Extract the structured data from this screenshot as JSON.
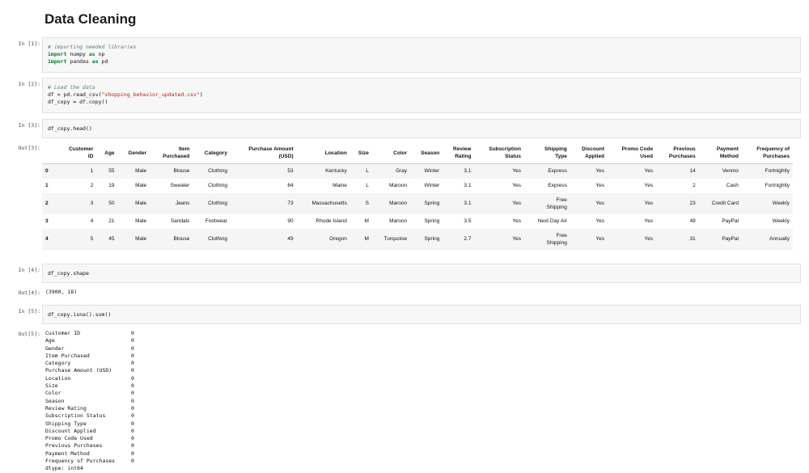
{
  "title": "Data Cleaning",
  "cells": [
    {
      "in": "In [1]:",
      "lines": [
        {
          "comment": "# importing needed libraries"
        },
        {
          "kw1": "import",
          "rest1": " numpy ",
          "kw2": "as",
          "rest2": " np"
        },
        {
          "kw1": "import",
          "rest1": " pandas ",
          "kw2": "as",
          "rest2": " pd"
        }
      ]
    },
    {
      "in": "In [2]:",
      "comment": "# Load the data",
      "line2_a": "df = pd.read_csv(",
      "line2_str": "\"shopping_behavior_updated.csv\"",
      "line2_b": ")",
      "line3": "df_copy = df.copy()"
    },
    {
      "in": "In [3]:",
      "code": "df_copy.head()",
      "out": "Out[3]:"
    },
    {
      "in": "In [4]:",
      "code": "df_copy.shape",
      "out": "Out[4]:",
      "result": "(3900, 18)"
    },
    {
      "in": "In [5]:",
      "code": "df_copy.isna().sum()",
      "out": "Out[5]:"
    }
  ],
  "table": {
    "columns": [
      [
        "Customer",
        "ID"
      ],
      [
        "Age",
        ""
      ],
      [
        "Gender",
        ""
      ],
      [
        "Item",
        "Purchased"
      ],
      [
        "Category",
        ""
      ],
      [
        "Purchase Amount",
        "(USD)"
      ],
      [
        "Location",
        ""
      ],
      [
        "Size",
        ""
      ],
      [
        "Color",
        ""
      ],
      [
        "Season",
        ""
      ],
      [
        "Review",
        "Rating"
      ],
      [
        "Subscription",
        "Status"
      ],
      [
        "Shipping",
        "Type"
      ],
      [
        "Discount",
        "Applied"
      ],
      [
        "Promo Code",
        "Used"
      ],
      [
        "Previous",
        "Purchases"
      ],
      [
        "Payment",
        "Method"
      ],
      [
        "Frequency of",
        "Purchases"
      ]
    ],
    "rows": [
      {
        "idx": "0",
        "cells": [
          "1",
          "55",
          "Male",
          "Blouse",
          "Clothing",
          "53",
          "Kentucky",
          "L",
          "Gray",
          "Winter",
          "3.1",
          "Yes",
          [
            "Express",
            ""
          ],
          "Yes",
          "Yes",
          "14",
          "Venmo",
          "Fortnightly"
        ]
      },
      {
        "idx": "1",
        "cells": [
          "2",
          "19",
          "Male",
          "Sweater",
          "Clothing",
          "64",
          "Maine",
          "L",
          "Maroon",
          "Winter",
          "3.1",
          "Yes",
          [
            "Express",
            ""
          ],
          "Yes",
          "Yes",
          "2",
          "Cash",
          "Fortnightly"
        ]
      },
      {
        "idx": "2",
        "cells": [
          "3",
          "50",
          "Male",
          "Jeans",
          "Clothing",
          "73",
          "Massachusetts",
          "S",
          "Maroon",
          "Spring",
          "3.1",
          "Yes",
          [
            "Free",
            "Shipping"
          ],
          "Yes",
          "Yes",
          "23",
          "Credit Card",
          "Weekly"
        ]
      },
      {
        "idx": "3",
        "cells": [
          "4",
          "21",
          "Male",
          "Sandals",
          "Footwear",
          "90",
          "Rhode Island",
          "M",
          "Maroon",
          "Spring",
          "3.5",
          "Yes",
          [
            "Next Day Air",
            ""
          ],
          "Yes",
          "Yes",
          "49",
          "PayPal",
          "Weekly"
        ]
      },
      {
        "idx": "4",
        "cells": [
          "5",
          "45",
          "Male",
          "Blouse",
          "Clothing",
          "49",
          "Oregon",
          "M",
          "Turquoise",
          "Spring",
          "2.7",
          "Yes",
          [
            "Free",
            "Shipping"
          ],
          "Yes",
          "Yes",
          "31",
          "PayPal",
          "Annually"
        ]
      }
    ]
  },
  "isna": {
    "items": [
      [
        "Customer ID",
        "0"
      ],
      [
        "Age",
        "0"
      ],
      [
        "Gender",
        "0"
      ],
      [
        "Item Purchased",
        "0"
      ],
      [
        "Category",
        "0"
      ],
      [
        "Purchase Amount (USD)",
        "0"
      ],
      [
        "Location",
        "0"
      ],
      [
        "Size",
        "0"
      ],
      [
        "Color",
        "0"
      ],
      [
        "Season",
        "0"
      ],
      [
        "Review Rating",
        "0"
      ],
      [
        "Subscription Status",
        "0"
      ],
      [
        "Shipping Type",
        "0"
      ],
      [
        "Discount Applied",
        "0"
      ],
      [
        "Promo Code Used",
        "0"
      ],
      [
        "Previous Purchases",
        "0"
      ],
      [
        "Payment Method",
        "0"
      ],
      [
        "Frequency of Purchases",
        "0"
      ]
    ],
    "dtype": "dtype: int64"
  }
}
